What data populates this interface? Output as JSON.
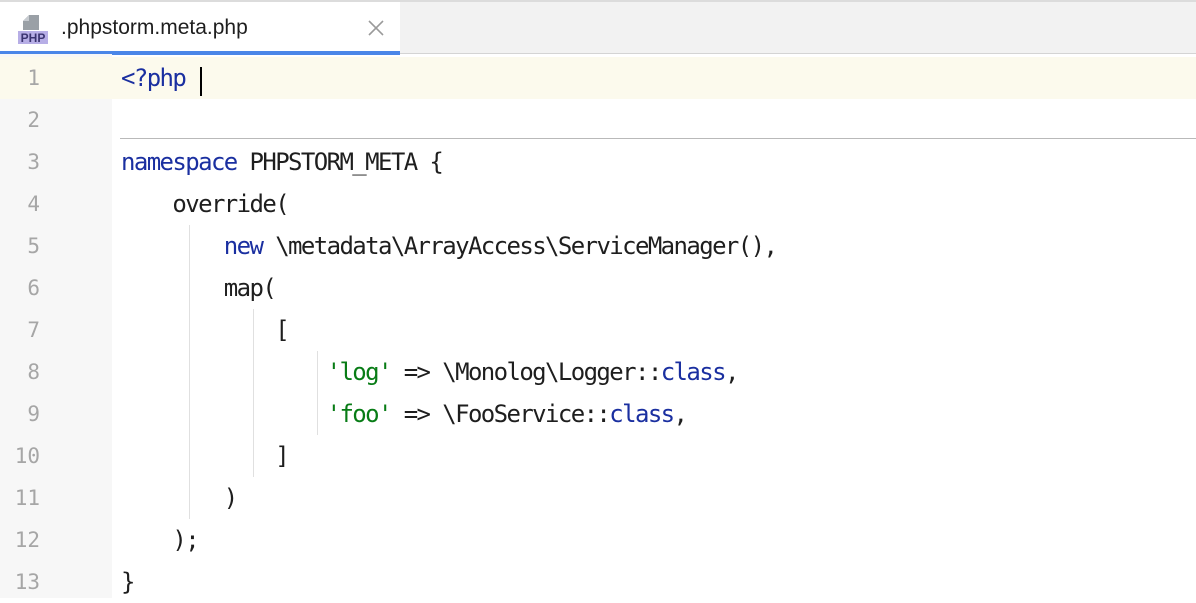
{
  "tab": {
    "title": ".phpstorm.meta.php",
    "icon": "php-file-icon",
    "icon_label": "PHP",
    "close_icon": "close-icon"
  },
  "colors": {
    "keyword": "#1a2fa0",
    "string": "#087c16",
    "text": "#1e1e1e",
    "line_number": "#a6a6a6",
    "current_line": "#fcfaed",
    "tab_accent": "#4a86e8"
  },
  "editor": {
    "lines": [
      {
        "number": "1",
        "indent": "",
        "tokens": [
          {
            "t": "<?php",
            "k": "kw"
          }
        ]
      },
      {
        "number": "2",
        "indent": "",
        "tokens": []
      },
      {
        "number": "3",
        "indent": "",
        "tokens": [
          {
            "t": "namespace",
            "k": "kw"
          },
          {
            "t": " PHPSTORM_META {",
            "k": ""
          }
        ]
      },
      {
        "number": "4",
        "indent": "    ",
        "tokens": [
          {
            "t": "override(",
            "k": ""
          }
        ]
      },
      {
        "number": "5",
        "indent": "        ",
        "tokens": [
          {
            "t": "new",
            "k": "kw"
          },
          {
            "t": " \\metadata\\ArrayAccess\\ServiceManager(),",
            "k": ""
          }
        ]
      },
      {
        "number": "6",
        "indent": "        ",
        "tokens": [
          {
            "t": "map(",
            "k": ""
          }
        ]
      },
      {
        "number": "7",
        "indent": "            ",
        "tokens": [
          {
            "t": "[",
            "k": ""
          }
        ]
      },
      {
        "number": "8",
        "indent": "                ",
        "tokens": [
          {
            "t": "'log'",
            "k": "str"
          },
          {
            "t": " => \\Monolog\\Logger::",
            "k": ""
          },
          {
            "t": "class",
            "k": "kw"
          },
          {
            "t": ",",
            "k": ""
          }
        ]
      },
      {
        "number": "9",
        "indent": "                ",
        "tokens": [
          {
            "t": "'foo'",
            "k": "str"
          },
          {
            "t": " => \\FooService::",
            "k": ""
          },
          {
            "t": "class",
            "k": "kw"
          },
          {
            "t": ",",
            "k": ""
          }
        ]
      },
      {
        "number": "10",
        "indent": "            ",
        "tokens": [
          {
            "t": "]",
            "k": ""
          }
        ]
      },
      {
        "number": "11",
        "indent": "        ",
        "tokens": [
          {
            "t": ")",
            "k": ""
          }
        ]
      },
      {
        "number": "12",
        "indent": "    ",
        "tokens": [
          {
            "t": ");",
            "k": ""
          }
        ]
      },
      {
        "number": "13",
        "indent": "",
        "tokens": [
          {
            "t": "}",
            "k": ""
          }
        ]
      }
    ]
  }
}
